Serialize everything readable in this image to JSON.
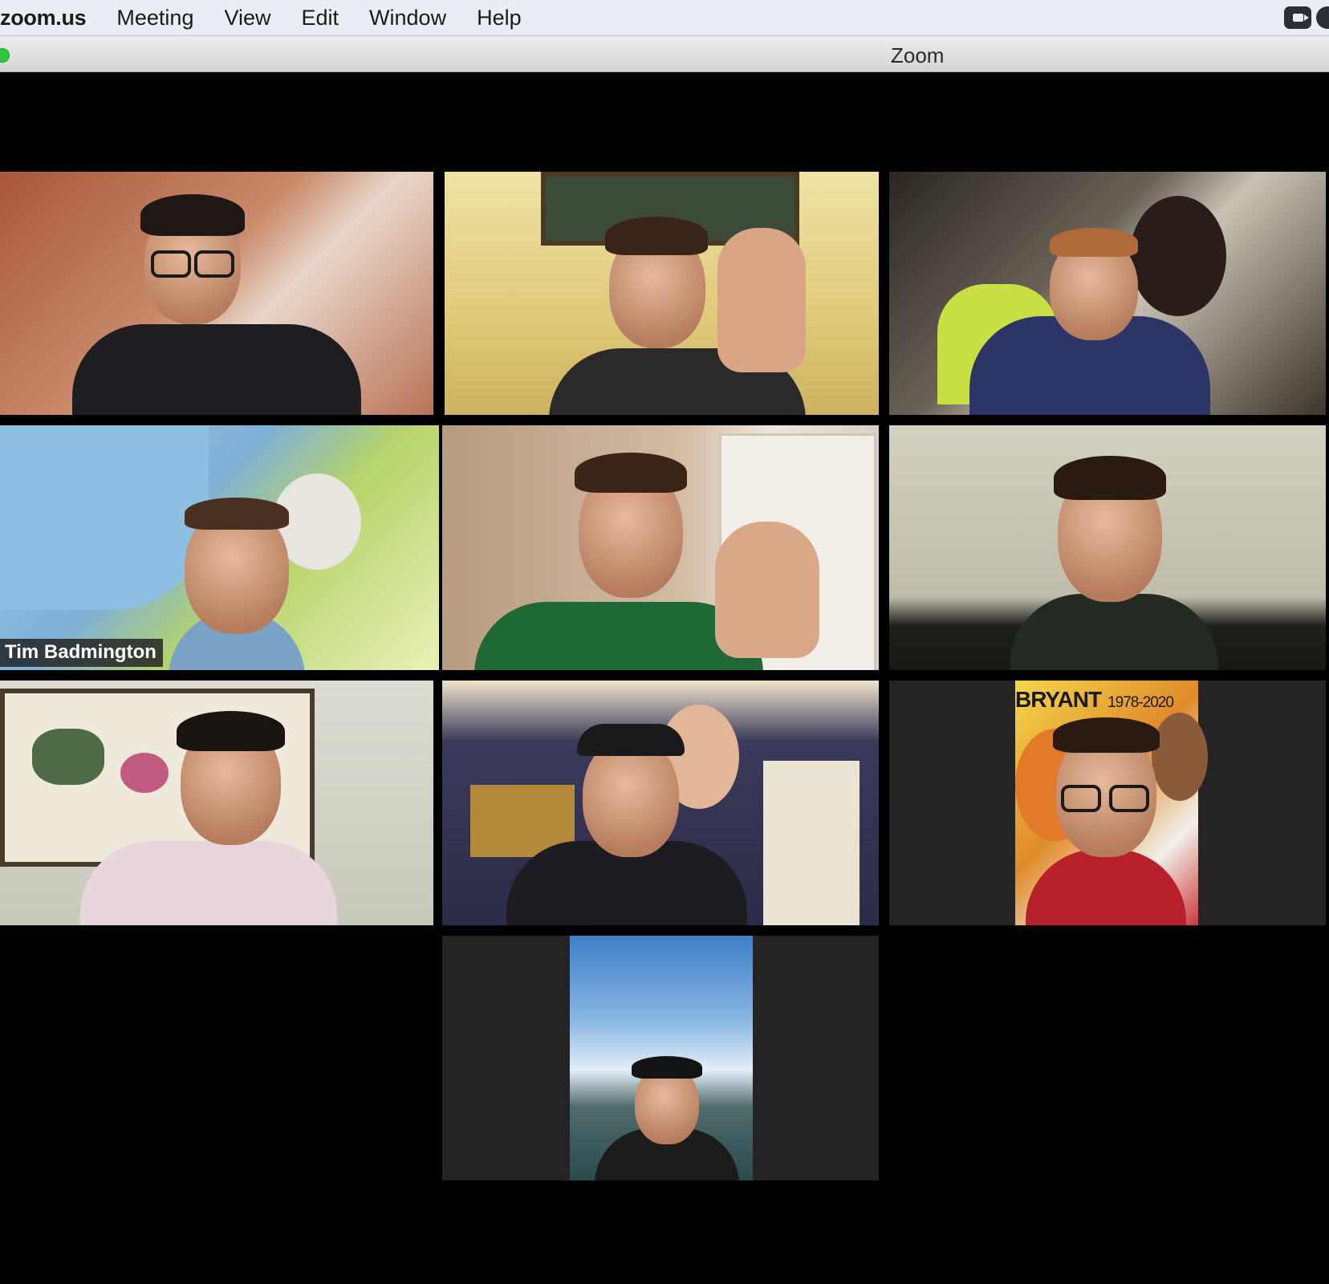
{
  "menubar": {
    "app_name": "zoom.us",
    "menus": [
      "Meeting",
      "View",
      "Edit",
      "Window",
      "Help"
    ]
  },
  "window": {
    "title": "Zoom"
  },
  "participants": [
    {
      "label": ""
    },
    {
      "label": ""
    },
    {
      "label": ""
    },
    {
      "label": "Tim Badmington",
      "active_speaker": true
    },
    {
      "label": ""
    },
    {
      "label": ""
    },
    {
      "label": ""
    },
    {
      "label": ""
    },
    {
      "label": ""
    },
    {
      "label": ""
    }
  ],
  "backgrounds": {
    "kobe_banner": "BRYANT",
    "kobe_years": "1978-2020"
  },
  "colors": {
    "active_speaker_border": "#d8e634",
    "menubar_bg": "#e9eef5",
    "gallery_bg": "#000000",
    "tile_bg": "#242424"
  }
}
